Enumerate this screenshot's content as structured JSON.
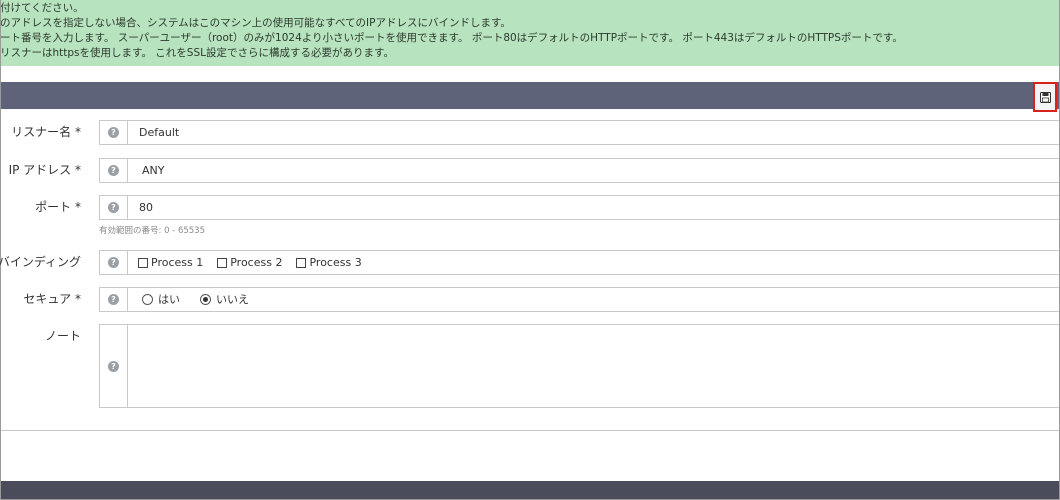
{
  "info": {
    "lines": [
      "付けてください。",
      "のアドレスを指定しない場合、システムはこのマシン上の使用可能なすべてのIPアドレスにバインドします。",
      "ート番号を入力します。 スーパーユーザー（root）のみが1024より小さいポートを使用できます。 ポート80はデフォルトのHTTPポートです。 ポート443はデフォルトのHTTPSポートです。",
      "リスナーはhttpsを使用します。 これをSSL設定でさらに構成する必要があります。"
    ]
  },
  "form": {
    "listener_name": {
      "label": "リスナー名 *",
      "value": "Default"
    },
    "ip_address": {
      "label": "IP アドレス *",
      "value": "ANY"
    },
    "port": {
      "label": "ポート *",
      "value": "80",
      "hint": "有効範囲の番号: 0 - 65535"
    },
    "binding": {
      "label": "バインディング",
      "options": [
        {
          "label": "Process 1",
          "checked": false
        },
        {
          "label": "Process 2",
          "checked": false
        },
        {
          "label": "Process 3",
          "checked": false
        }
      ]
    },
    "secure": {
      "label": "セキュア *",
      "options": [
        {
          "label": "はい",
          "selected": false
        },
        {
          "label": "いいえ",
          "selected": true
        }
      ]
    },
    "notes": {
      "label": "ノート",
      "value": ""
    }
  },
  "icons": {
    "save": "save-icon",
    "help": "help-icon"
  },
  "colors": {
    "banner": "#b8e3bf",
    "header_bar": "#5f6379",
    "highlight": "#d9201d"
  }
}
